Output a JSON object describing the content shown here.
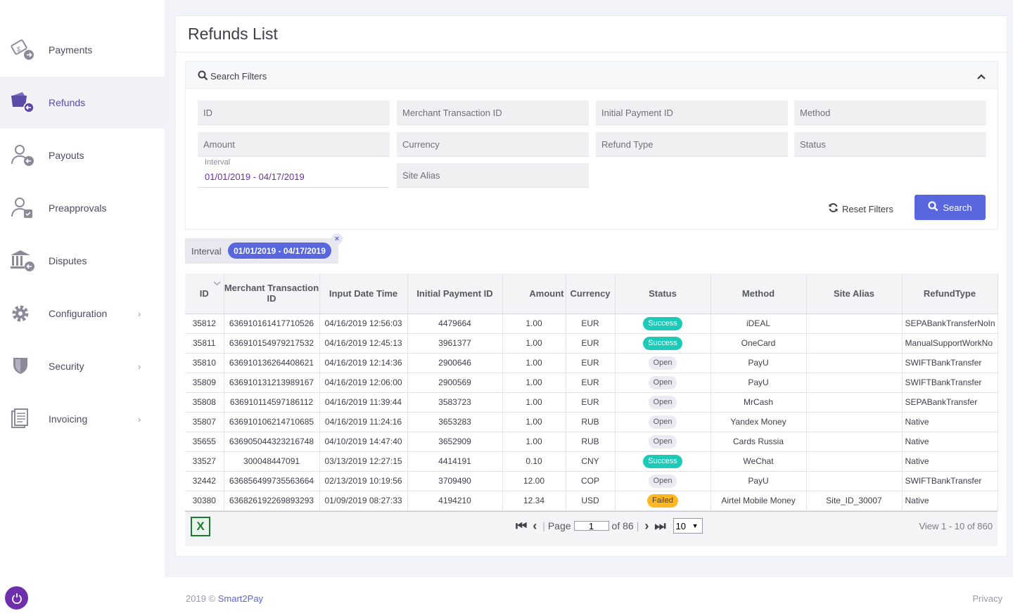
{
  "sidebar": {
    "items": [
      {
        "label": "Payments",
        "icon": "payments-icon"
      },
      {
        "label": "Refunds",
        "icon": "refunds-icon",
        "active": true
      },
      {
        "label": "Payouts",
        "icon": "payouts-icon"
      },
      {
        "label": "Preapprovals",
        "icon": "preapprovals-icon"
      },
      {
        "label": "Disputes",
        "icon": "disputes-icon"
      },
      {
        "label": "Configuration",
        "icon": "gear-icon",
        "expandable": true
      },
      {
        "label": "Security",
        "icon": "shield-icon",
        "expandable": true
      },
      {
        "label": "Invoicing",
        "icon": "invoice-icon",
        "expandable": true
      }
    ],
    "chevron": "›"
  },
  "page": {
    "title": "Refunds List"
  },
  "filters": {
    "title": "Search Filters",
    "placeholders": {
      "id": "ID",
      "merchant_transaction_id": "Merchant Transaction ID",
      "initial_payment_id": "Initial Payment ID",
      "method": "Method",
      "amount": "Amount",
      "currency": "Currency",
      "refund_type": "Refund Type",
      "status": "Status",
      "site_alias": "Site Alias"
    },
    "interval_label": "Interval",
    "interval_value": "01/01/2019 - 04/17/2019",
    "reset_label": "Reset Filters",
    "search_label": "Search"
  },
  "active_filter": {
    "label": "Interval",
    "value": "01/01/2019 - 04/17/2019",
    "close": "×"
  },
  "table": {
    "headers": [
      "ID",
      "Merchant Transaction ID",
      "Input Date Time",
      "Initial Payment ID",
      "Amount",
      "Currency",
      "Status",
      "Method",
      "Site Alias",
      "RefundType"
    ],
    "rows": [
      {
        "id": "35812",
        "mtid": "636910161417710526",
        "date": "04/16/2019 12:56:03",
        "ipid": "4479664",
        "amount": "1.00",
        "currency": "EUR",
        "status": "Success",
        "method": "iDEAL",
        "site": "",
        "type": "SEPABankTransferNoIn"
      },
      {
        "id": "35811",
        "mtid": "636910154979217532",
        "date": "04/16/2019 12:45:13",
        "ipid": "3961377",
        "amount": "1.00",
        "currency": "EUR",
        "status": "Success",
        "method": "OneCard",
        "site": "",
        "type": "ManualSupportWorkNo"
      },
      {
        "id": "35810",
        "mtid": "636910136264408621",
        "date": "04/16/2019 12:14:36",
        "ipid": "2900646",
        "amount": "1.00",
        "currency": "EUR",
        "status": "Open",
        "method": "PayU",
        "site": "",
        "type": "SWIFTBankTransfer"
      },
      {
        "id": "35809",
        "mtid": "636910131213989167",
        "date": "04/16/2019 12:06:00",
        "ipid": "2900569",
        "amount": "1.00",
        "currency": "EUR",
        "status": "Open",
        "method": "PayU",
        "site": "",
        "type": "SWIFTBankTransfer"
      },
      {
        "id": "35808",
        "mtid": "636910114597186112",
        "date": "04/16/2019 11:39:44",
        "ipid": "3583723",
        "amount": "1.00",
        "currency": "EUR",
        "status": "Open",
        "method": "MrCash",
        "site": "",
        "type": "SEPABankTransfer"
      },
      {
        "id": "35807",
        "mtid": "636910106214710685",
        "date": "04/16/2019 11:24:16",
        "ipid": "3653283",
        "amount": "1.00",
        "currency": "RUB",
        "status": "Open",
        "method": "Yandex Money",
        "site": "",
        "type": "Native"
      },
      {
        "id": "35655",
        "mtid": "636905044323216748",
        "date": "04/10/2019 14:47:40",
        "ipid": "3652909",
        "amount": "1.00",
        "currency": "RUB",
        "status": "Open",
        "method": "Cards Russia",
        "site": "",
        "type": "Native"
      },
      {
        "id": "33527",
        "mtid": "300048447091",
        "date": "03/13/2019 12:27:15",
        "ipid": "4414191",
        "amount": "0.10",
        "currency": "CNY",
        "status": "Success",
        "method": "WeChat",
        "site": "",
        "type": "Native"
      },
      {
        "id": "32442",
        "mtid": "636856499735563664",
        "date": "02/13/2019 10:19:56",
        "ipid": "3709490",
        "amount": "12.00",
        "currency": "COP",
        "status": "Open",
        "method": "PayU",
        "site": "",
        "type": "SWIFTBankTransfer"
      },
      {
        "id": "30380",
        "mtid": "636826192269893293",
        "date": "01/09/2019 08:27:33",
        "ipid": "4194210",
        "amount": "12.34",
        "currency": "USD",
        "status": "Failed",
        "method": "Airtel Mobile Money",
        "site": "Site_ID_30007",
        "type": "Native"
      }
    ]
  },
  "pager": {
    "page_label": "Page",
    "page_value": "1",
    "of_label": "of 86",
    "rows_per_page": "10",
    "view_info": "View 1 - 10 of 860",
    "excel_icon": "excel-icon"
  },
  "footer": {
    "year": "2019 ©",
    "brand": "Smart2Pay",
    "privacy": "Privacy"
  },
  "colors": {
    "accent": "#5867dd",
    "success": "#1dc9b7",
    "warning": "#ffb822",
    "brand_purple": "#6f2eab"
  }
}
